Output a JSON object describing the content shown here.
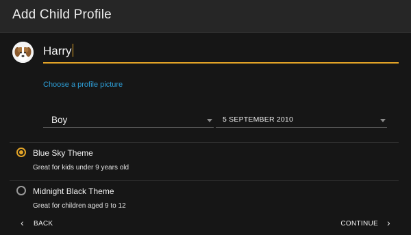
{
  "header": {
    "title": "Add Child Profile"
  },
  "profile": {
    "avatar_icon": "puppy-avatar-icon",
    "name_value": "Harry",
    "choose_picture_label": "Choose a profile picture"
  },
  "gender_select": {
    "value": "Boy"
  },
  "birthdate_select": {
    "value": "5 SEPTEMBER 2010"
  },
  "themes": [
    {
      "title": "Blue Sky Theme",
      "description": "Great for kids under 9 years old",
      "selected": true
    },
    {
      "title": "Midnight Black Theme",
      "description": "Great for children aged 9 to 12",
      "selected": false
    }
  ],
  "footer": {
    "back_label": "BACK",
    "continue_label": "CONTINUE"
  },
  "colors": {
    "accent": "#e3a427",
    "link": "#2d9fd8",
    "background": "#161616",
    "header_bg": "#262626"
  }
}
